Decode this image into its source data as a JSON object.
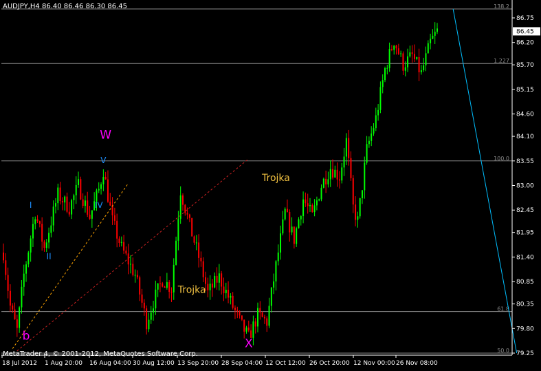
{
  "header": {
    "title": "AUDJPY,H4 86.40 86.46 86.30 86.45"
  },
  "footer": {
    "copyright": "MetaTrader 4, © 2001-2012, MetaQuotes Software Corp."
  },
  "colors": {
    "background": "#000000",
    "axis": "#ffffff",
    "bull": "#00ff00",
    "bear": "#ff0000",
    "fib": "#8a8a8a",
    "wave_small": "#1e90ff",
    "wave_big": "#ff00ff",
    "label_orange": "#f0c040",
    "trend_orange": "#ffa500",
    "trend_red": "#cc2222",
    "cyan": "#00bfff"
  },
  "chart_data": {
    "type": "candlestick",
    "symbol": "AUDJPY",
    "timeframe": "H4",
    "current_price": 86.45,
    "ylim": [
      79.25,
      86.75
    ],
    "y_ticks": [
      "86.75",
      "86.20",
      "85.70",
      "85.15",
      "84.60",
      "84.10",
      "83.55",
      "83.00",
      "82.45",
      "81.95",
      "81.40",
      "80.85",
      "80.35",
      "79.80",
      "79.25"
    ],
    "x_ticks": [
      "18 Jul 2012",
      "1 Aug 20:00",
      "16 Aug 04:00",
      "30 Aug 12:00",
      "13 Sep 20:00",
      "28 Sep 04:00",
      "12 Oct 12:00",
      "26 Oct 20:00",
      "12 Nov 00:00",
      "26 Nov 08:00"
    ],
    "fib_levels": [
      {
        "label": "138.2",
        "price": 86.95
      },
      {
        "label": "1.227",
        "price": 85.73
      },
      {
        "label": "100.0",
        "price": 83.55
      },
      {
        "label": "61.8",
        "price": 80.18
      },
      {
        "label": "50.0",
        "price": 79.25
      }
    ],
    "path": [
      {
        "t": 0,
        "p": 81.5
      },
      {
        "t": 3,
        "p": 80.3
      },
      {
        "t": 6,
        "p": 79.75
      },
      {
        "t": 9,
        "p": 81.0
      },
      {
        "t": 14,
        "p": 82.4
      },
      {
        "t": 18,
        "p": 81.6
      },
      {
        "t": 24,
        "p": 82.8
      },
      {
        "t": 29,
        "p": 82.5
      },
      {
        "t": 33,
        "p": 83.0
      },
      {
        "t": 38,
        "p": 82.3
      },
      {
        "t": 42,
        "p": 82.9
      },
      {
        "t": 44,
        "p": 83.35
      },
      {
        "t": 48,
        "p": 82.2
      },
      {
        "t": 52,
        "p": 81.6
      },
      {
        "t": 58,
        "p": 81.0
      },
      {
        "t": 63,
        "p": 79.95
      },
      {
        "t": 66,
        "p": 80.4
      },
      {
        "t": 70,
        "p": 80.9
      },
      {
        "t": 74,
        "p": 80.7
      },
      {
        "t": 78,
        "p": 82.9
      },
      {
        "t": 82,
        "p": 82.1
      },
      {
        "t": 86,
        "p": 81.4
      },
      {
        "t": 90,
        "p": 80.6
      },
      {
        "t": 95,
        "p": 80.95
      },
      {
        "t": 100,
        "p": 80.4
      },
      {
        "t": 105,
        "p": 79.85
      },
      {
        "t": 108,
        "p": 79.6
      },
      {
        "t": 112,
        "p": 80.1
      },
      {
        "t": 116,
        "p": 79.95
      },
      {
        "t": 120,
        "p": 81.2
      },
      {
        "t": 124,
        "p": 82.4
      },
      {
        "t": 128,
        "p": 81.8
      },
      {
        "t": 132,
        "p": 82.7
      },
      {
        "t": 136,
        "p": 82.3
      },
      {
        "t": 140,
        "p": 83.0
      },
      {
        "t": 144,
        "p": 83.4
      },
      {
        "t": 148,
        "p": 83.2
      },
      {
        "t": 151,
        "p": 84.0
      },
      {
        "t": 154,
        "p": 82.5
      },
      {
        "t": 156,
        "p": 82.2
      },
      {
        "t": 160,
        "p": 83.8
      },
      {
        "t": 164,
        "p": 84.5
      },
      {
        "t": 168,
        "p": 85.6
      },
      {
        "t": 172,
        "p": 86.25
      },
      {
        "t": 176,
        "p": 85.7
      },
      {
        "t": 180,
        "p": 85.9
      },
      {
        "t": 184,
        "p": 85.5
      },
      {
        "t": 188,
        "p": 86.2
      },
      {
        "t": 191,
        "p": 86.45
      }
    ],
    "annotations": [
      {
        "text": "W",
        "t": 45,
        "p": 84.05,
        "kind": "big"
      },
      {
        "text": "V",
        "t": 44,
        "p": 83.5,
        "kind": "small"
      },
      {
        "text": "IV",
        "t": 42,
        "p": 82.5,
        "kind": "small"
      },
      {
        "text": "I",
        "t": 12,
        "p": 82.5,
        "kind": "small"
      },
      {
        "text": "II",
        "t": 20,
        "p": 81.35,
        "kind": "small"
      },
      {
        "text": "b",
        "t": 10,
        "p": 79.55,
        "kind": "big"
      },
      {
        "text": "X",
        "t": 108,
        "p": 79.38,
        "kind": "big"
      },
      {
        "text": "Trojka",
        "t": 83,
        "p": 80.6,
        "kind": "orange"
      },
      {
        "text": "Trojka",
        "t": 120,
        "p": 83.1,
        "kind": "orange"
      }
    ],
    "trend_lines": [
      {
        "t1": 4,
        "p1": 79.35,
        "t2": 55,
        "p2": 83.05,
        "style": "orange-dash"
      },
      {
        "t1": 6,
        "p1": 79.3,
        "t2": 108,
        "p2": 83.6,
        "style": "red-dash"
      },
      {
        "t1": 198,
        "p1": 86.95,
        "t2": 226,
        "p2": 79.25,
        "style": "cyan-solid"
      }
    ]
  }
}
